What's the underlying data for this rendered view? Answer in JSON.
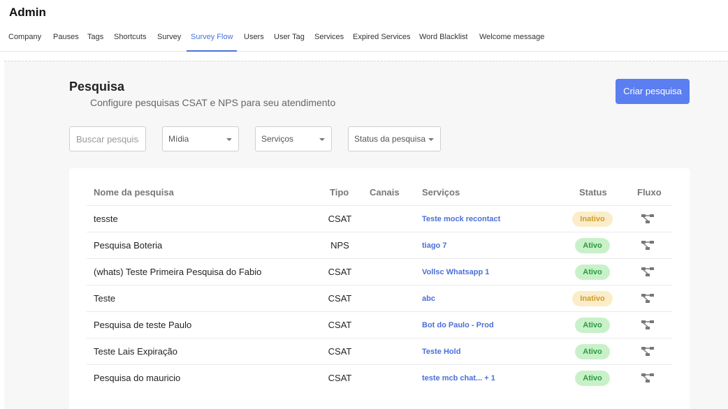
{
  "header": {
    "title": "Admin"
  },
  "nav": {
    "tabs": [
      {
        "label": "Company"
      },
      {
        "label": "Pauses"
      },
      {
        "label": "Tags"
      },
      {
        "label": "Shortcuts"
      },
      {
        "label": "Survey"
      },
      {
        "label": "Survey Flow"
      },
      {
        "label": "Users"
      },
      {
        "label": "User Tag"
      },
      {
        "label": "Services"
      },
      {
        "label": "Expired Services"
      },
      {
        "label": "Word Blacklist"
      },
      {
        "label": "Welcome message"
      }
    ],
    "active": "Survey Flow"
  },
  "page": {
    "title": "Pesquisa",
    "subtitle": "Configure pesquisas CSAT e NPS para seu atendimento",
    "create_button": "Criar pesquisa"
  },
  "filters": {
    "search_placeholder": "Buscar pesquisa",
    "media": "Mídia",
    "services": "Serviços",
    "status": "Status da pesquisa"
  },
  "table": {
    "headers": {
      "name": "Nome da pesquisa",
      "type": "Tipo",
      "channels": "Canais",
      "services": "Serviços",
      "status": "Status",
      "flow": "Fluxo"
    },
    "rows": [
      {
        "name": "tesste",
        "type": "CSAT",
        "service": "Teste mock recontact",
        "status": "Inativo"
      },
      {
        "name": "Pesquisa Boteria",
        "type": "NPS",
        "service": "tiago 7",
        "status": "Ativo"
      },
      {
        "name": "(whats) Teste Primeira Pesquisa do Fabio",
        "type": "CSAT",
        "service": "Vollsc Whatsapp 1",
        "status": "Ativo"
      },
      {
        "name": "Teste",
        "type": "CSAT",
        "service": "abc",
        "status": "Inativo"
      },
      {
        "name": "Pesquisa de teste Paulo",
        "type": "CSAT",
        "service": "Bot do Paulo - Prod",
        "status": "Ativo"
      },
      {
        "name": "Teste Lais Expiração",
        "type": "CSAT",
        "service": "Teste Hold",
        "status": "Ativo"
      },
      {
        "name": "Pesquisa do mauricio",
        "type": "CSAT",
        "service": "teste mcb chat... + 1",
        "status": "Ativo"
      }
    ]
  },
  "colors": {
    "accent": "#4a72d9",
    "button": "#5b7ef0",
    "inactive_bg": "#fbedc9",
    "inactive_text": "#d29b2a",
    "active_bg": "#c9f1c9",
    "active_text": "#2a9a3f"
  },
  "icons": {
    "flow": "flow-diagram-icon",
    "caret": "caret-down-icon"
  }
}
